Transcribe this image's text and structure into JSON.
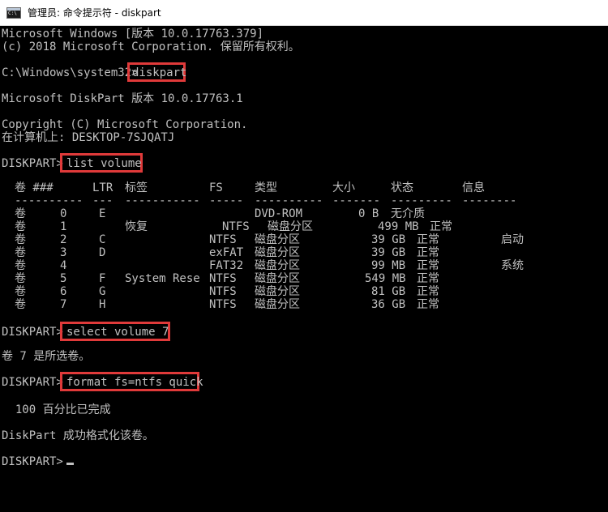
{
  "window": {
    "title": "管理员: 命令提示符 - diskpart"
  },
  "console": {
    "line1": "Microsoft Windows [版本 10.0.17763.379]",
    "line2": "(c) 2018 Microsoft Corporation. 保留所有权利。",
    "prompt1": "C:\\Windows\\system32>",
    "cmd1": "diskpart",
    "version": "Microsoft DiskPart 版本 10.0.17763.1",
    "copyright": "Copyright (C) Microsoft Corporation.",
    "computer": "在计算机上: DESKTOP-7SJQATJ",
    "prompt2": "DISKPART>",
    "cmd2": "list volume",
    "table": {
      "headers": [
        "卷 ###",
        "LTR",
        "标签",
        "FS",
        "类型",
        "大小",
        "状态",
        "信息"
      ],
      "separators": [
        "----------",
        "---",
        "-----------",
        "-----",
        "----------",
        "-------",
        "---------",
        "--------"
      ],
      "rows": [
        {
          "vol": "卷",
          "num": "0",
          "ltr": "E",
          "label": "",
          "fs": "",
          "type": "DVD-ROM",
          "size": "0 B",
          "status": "无介质",
          "info": ""
        },
        {
          "vol": "卷",
          "num": "1",
          "ltr": "",
          "label": "恢复",
          "fs": "NTFS",
          "type": "磁盘分区",
          "size": "499 MB",
          "status": "正常",
          "info": ""
        },
        {
          "vol": "卷",
          "num": "2",
          "ltr": "C",
          "label": "",
          "fs": "NTFS",
          "type": "磁盘分区",
          "size": "39 GB",
          "status": "正常",
          "info": "启动"
        },
        {
          "vol": "卷",
          "num": "3",
          "ltr": "D",
          "label": "",
          "fs": "exFAT",
          "type": "磁盘分区",
          "size": "39 GB",
          "status": "正常",
          "info": ""
        },
        {
          "vol": "卷",
          "num": "4",
          "ltr": "",
          "label": "",
          "fs": "FAT32",
          "type": "磁盘分区",
          "size": "99 MB",
          "status": "正常",
          "info": "系统"
        },
        {
          "vol": "卷",
          "num": "5",
          "ltr": "F",
          "label": "System Rese",
          "fs": "NTFS",
          "type": "磁盘分区",
          "size": "549 MB",
          "status": "正常",
          "info": ""
        },
        {
          "vol": "卷",
          "num": "6",
          "ltr": "G",
          "label": "",
          "fs": "NTFS",
          "type": "磁盘分区",
          "size": "81 GB",
          "status": "正常",
          "info": ""
        },
        {
          "vol": "卷",
          "num": "7",
          "ltr": "H",
          "label": "",
          "fs": "NTFS",
          "type": "磁盘分区",
          "size": "36 GB",
          "status": "正常",
          "info": ""
        }
      ]
    },
    "prompt3": "DISKPART>",
    "cmd3": "select volume 7",
    "selected": "卷 7 是所选卷。",
    "prompt4": "DISKPART>",
    "cmd4": "format fs=ntfs quick",
    "progress": "  100 百分比已完成",
    "done": "DiskPart 成功格式化该卷。",
    "prompt5": "DISKPART>"
  },
  "colors": {
    "background": "#000000",
    "text": "#c0c0c0",
    "highlight_box": "#e03a3a"
  }
}
